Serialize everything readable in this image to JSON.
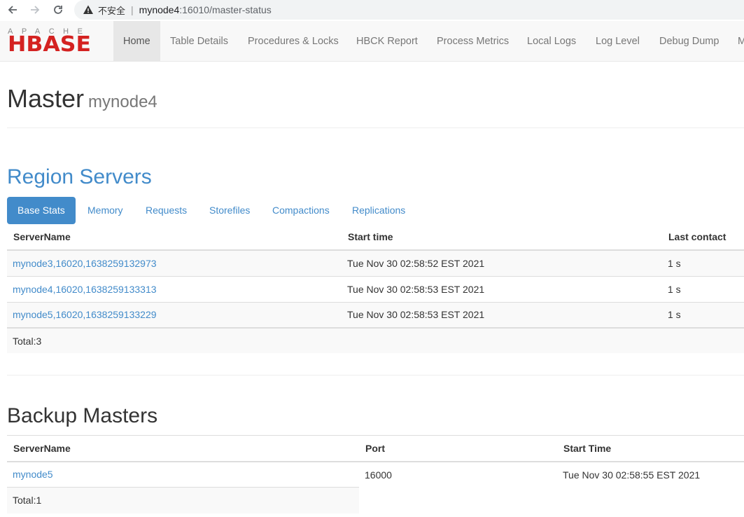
{
  "browser": {
    "insecure_label": "不安全",
    "url_host": "mynode4",
    "url_path": ":16010/master-status"
  },
  "logo": {
    "top": "APACHE",
    "main": "HBASE"
  },
  "nav": {
    "items": [
      "Home",
      "Table Details",
      "Procedures & Locks",
      "HBCK Report",
      "Process Metrics",
      "Local Logs",
      "Log Level",
      "Debug Dump",
      "M"
    ]
  },
  "header": {
    "title": "Master",
    "host": "mynode4"
  },
  "region_servers": {
    "title": "Region Servers",
    "tabs": [
      "Base Stats",
      "Memory",
      "Requests",
      "Storefiles",
      "Compactions",
      "Replications"
    ],
    "columns": [
      "ServerName",
      "Start time",
      "Last contact"
    ],
    "rows": [
      [
        "mynode3,16020,1638259132973",
        "Tue Nov 30 02:58:52 EST 2021",
        "1 s"
      ],
      [
        "mynode4,16020,1638259133313",
        "Tue Nov 30 02:58:53 EST 2021",
        "1 s"
      ],
      [
        "mynode5,16020,1638259133229",
        "Tue Nov 30 02:58:53 EST 2021",
        "1 s"
      ]
    ],
    "total": "Total:3"
  },
  "backup_masters": {
    "title": "Backup Masters",
    "columns": [
      "ServerName",
      "Port",
      "Start Time"
    ],
    "rows": [
      [
        "mynode5",
        "16000",
        "Tue Nov 30 02:58:55 EST 2021"
      ]
    ],
    "total": "Total:1"
  },
  "colors": {
    "accent": "#428bca",
    "logo_red": "#d42221"
  }
}
